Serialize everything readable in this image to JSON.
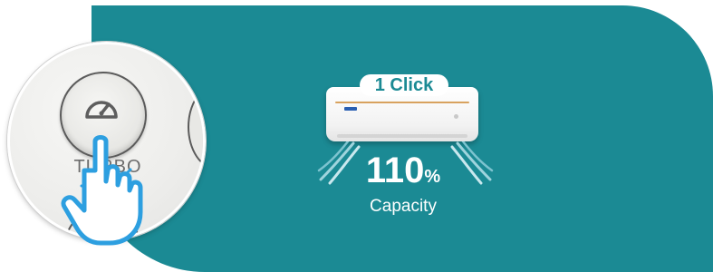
{
  "badge": {
    "text": "1 Click"
  },
  "remote": {
    "button_label": "TURBO"
  },
  "capacity": {
    "value": "110",
    "unit": "%",
    "label": "Capacity"
  },
  "colors": {
    "panel": "#1b8a94",
    "accent_blue": "#2d9fe0",
    "text_on_panel": "#ffffff"
  },
  "icons": [
    "speedometer-icon",
    "pointing-hand-icon",
    "air-conditioner-icon",
    "airflow-icon"
  ]
}
